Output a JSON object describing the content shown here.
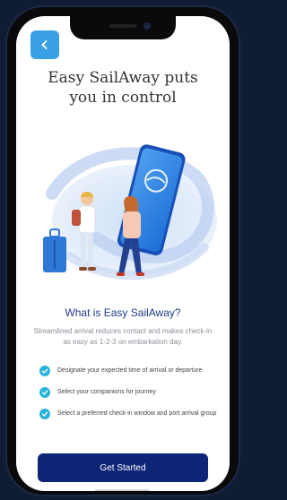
{
  "header": {
    "back_icon": "chevron-left-icon"
  },
  "hero": {
    "title_line1": "Easy SailAway puts",
    "title_line2": "you in control"
  },
  "info": {
    "heading": "What is Easy SailAway?",
    "description": "Streamlined arrival reduces contact and makes check-in as easy as 1-2-3 on embarkation day."
  },
  "features": [
    {
      "icon": "check-circle-icon",
      "label": "Designate your expected time of arrival or departure"
    },
    {
      "icon": "check-circle-icon",
      "label": "Select your companions for journey"
    },
    {
      "icon": "check-circle-icon",
      "label": "Select a preferred check-in window and port arrival group"
    }
  ],
  "cta": {
    "label": "Get Started"
  },
  "colors": {
    "accent": "#3aa0e4",
    "brand_navy": "#0c2577",
    "check": "#2ab3d8"
  }
}
